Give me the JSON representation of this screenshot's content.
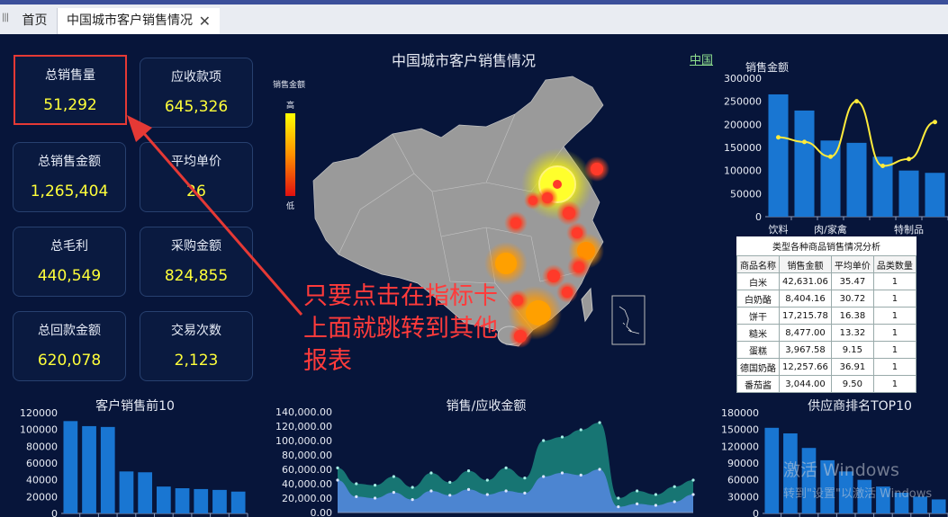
{
  "tabs": {
    "home": "首页",
    "active": "中国城市客户销售情况",
    "close": "✕",
    "grip": "|||"
  },
  "kpis": [
    {
      "label": "总销售量",
      "value": "51,292"
    },
    {
      "label": "应收款项",
      "value": "645,326"
    },
    {
      "label": "总销售金额",
      "value": "1,265,404"
    },
    {
      "label": "平均单价",
      "value": "26"
    },
    {
      "label": "总毛利",
      "value": "440,549"
    },
    {
      "label": "采购金额",
      "value": "824,855"
    },
    {
      "label": "总回款金额",
      "value": "620,078"
    },
    {
      "label": "交易次数",
      "value": "2,123"
    }
  ],
  "map": {
    "title": "中国城市客户销售情况",
    "region_link": "中国",
    "legend_title": "销售金额",
    "legend_high": "高",
    "legend_low": "低"
  },
  "annotation": "只要点击在指标卡上面就跳转到其他报表",
  "sales_chart_title": "销售金额",
  "category_table": {
    "caption": "类型各种商品销售情况分析",
    "headers": [
      "商品名称",
      "销售金额",
      "平均单价",
      "品类数量"
    ],
    "rows": [
      [
        "白米",
        "42,631.06",
        "35.47",
        "1"
      ],
      [
        "白奶酪",
        "8,404.16",
        "30.72",
        "1"
      ],
      [
        "饼干",
        "17,215.78",
        "16.38",
        "1"
      ],
      [
        "糙米",
        "8,477.00",
        "13.32",
        "1"
      ],
      [
        "蛋糕",
        "3,967.58",
        "9.15",
        "1"
      ],
      [
        "德国奶酪",
        "12,257.66",
        "36.91",
        "1"
      ],
      [
        "番茄酱",
        "3,044.00",
        "9.50",
        "1"
      ]
    ]
  },
  "bottom_titles": {
    "left": "客户销售前10",
    "mid": "销售/应收金额",
    "right": "供应商排名TOP10"
  },
  "watermark": {
    "line1": "激活 Windows",
    "line2": "转到\"设置\"以激活 Windows"
  },
  "colors": {
    "bar": "#1976d2",
    "line": "#ffeb3b",
    "highlight": "#e53935",
    "teal": "#1a7f7a"
  },
  "chart_data": [
    {
      "type": "bar",
      "title": "销售金额",
      "categories": [
        "饮料",
        "",
        "肉/家禽",
        "",
        "",
        "特制品"
      ],
      "series": [
        {
          "values": [
            265000,
            230000,
            165000,
            160000,
            130000,
            100000,
            95000
          ]
        },
        {
          "values": [
            172000,
            162000,
            130000,
            250000,
            110000,
            125000,
            205000
          ]
        }
      ],
      "ylim": [
        0,
        300000
      ],
      "yticks": [
        "300000",
        "250000",
        "200000",
        "150000",
        "100000",
        "50000",
        "0"
      ]
    },
    {
      "type": "bar",
      "title": "客户销售前10",
      "values": [
        110000,
        104000,
        103000,
        50000,
        49000,
        32000,
        30000,
        29000,
        28000,
        26000
      ],
      "ylim": [
        0,
        120000
      ],
      "yticks": [
        "120000",
        "100000",
        "80000",
        "60000",
        "40000",
        "20000",
        "0"
      ]
    },
    {
      "type": "area",
      "title": "销售/应收金额",
      "series": [
        {
          "values": [
            62000,
            40000,
            38000,
            50000,
            35000,
            55000,
            42000,
            58000,
            45000,
            62000,
            48000,
            100000,
            105000,
            115000,
            125000,
            20000,
            30000,
            25000,
            36000,
            45000
          ]
        },
        {
          "values": [
            45000,
            22000,
            20000,
            28000,
            18000,
            30000,
            24000,
            32000,
            25000,
            30000,
            27000,
            50000,
            55000,
            52000,
            60000,
            8000,
            12000,
            10000,
            15000,
            25000
          ]
        }
      ],
      "ylim": [
        0,
        140000
      ],
      "yticks": [
        "140,000.00",
        "120,000.00",
        "100,000.00",
        "80,000.00",
        "60,000.00",
        "40,000.00",
        "20,000.00",
        "0.00"
      ]
    },
    {
      "type": "bar",
      "title": "供应商排名TOP10",
      "values": [
        153000,
        143000,
        117000,
        95000,
        75000,
        60000,
        48000,
        37000,
        30000,
        25000
      ],
      "ylim": [
        0,
        180000
      ],
      "yticks": [
        "180000",
        "150000",
        "120000",
        "90000",
        "60000",
        "30000",
        "0"
      ]
    }
  ]
}
